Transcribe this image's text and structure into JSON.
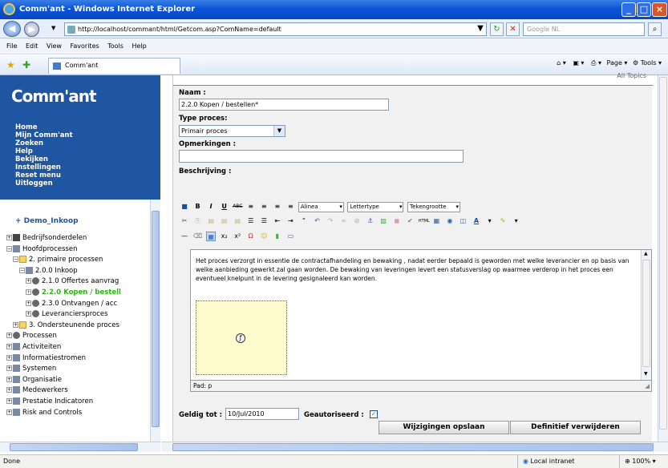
{
  "window": {
    "title": "Comm'ant - Windows Internet Explorer"
  },
  "address": {
    "url": "http://localhost/commant/html/Getcom.asp?ComName=default",
    "search_placeholder": "Google NL"
  },
  "menu": [
    "File",
    "Edit",
    "View",
    "Favorites",
    "Tools",
    "Help"
  ],
  "favbar": {
    "tab_label": "Comm'ant",
    "page_label": "Page",
    "tools_label": "Tools"
  },
  "sidebar": {
    "logo": "Comm'ant",
    "nav": [
      "Home",
      "Mijn Comm'ant",
      "Zoeken",
      "Help",
      "Bekijken",
      "Instellingen",
      "Reset menu",
      "Uitloggen"
    ],
    "tree_title": "+ Demo_Inkoop",
    "tree": [
      {
        "label": "Bedrijfsonderdelen",
        "indent": 0,
        "icon": "sq-icon"
      },
      {
        "label": "Hoofdprocessen",
        "indent": 0,
        "icon": "grid-icon"
      },
      {
        "label": "2. primaire processen",
        "indent": 1,
        "icon": "folder-icon"
      },
      {
        "label": "2.0.0 Inkoop",
        "indent": 2,
        "icon": "grid-icon"
      },
      {
        "label": "2.1.0 Offertes aanvrag",
        "indent": 3,
        "icon": "gear-icon"
      },
      {
        "label": "2.2.0 Kopen / bestell",
        "indent": 3,
        "icon": "gear-icon",
        "active": true
      },
      {
        "label": "2.3.0 Ontvangen / acc",
        "indent": 3,
        "icon": "gear-icon"
      },
      {
        "label": "Leveranciersproces",
        "indent": 3,
        "icon": "gear-icon"
      },
      {
        "label": "3. Ondersteunende proces",
        "indent": 1,
        "icon": "folder-icon"
      },
      {
        "label": "Processen",
        "indent": 0,
        "icon": "gear-icon"
      },
      {
        "label": "Activiteiten",
        "indent": 0,
        "icon": "grid-icon"
      },
      {
        "label": "Informatiestromen",
        "indent": 0,
        "icon": "info-icon"
      },
      {
        "label": "Systemen",
        "indent": 0,
        "icon": "monitor-icon"
      },
      {
        "label": "Organisatie",
        "indent": 0,
        "icon": "org-icon"
      },
      {
        "label": "Medewerkers",
        "indent": 0,
        "icon": "people-icon"
      },
      {
        "label": "Prestatie Indicatoren",
        "indent": 0,
        "icon": "gauge-icon"
      },
      {
        "label": "Risk and Controls",
        "indent": 0,
        "icon": "warning-icon"
      }
    ]
  },
  "form": {
    "top_right": "All Topics",
    "naam_label": "Naam :",
    "naam_value": "2.2.0 Kopen / bestellen*",
    "type_label": "Type proces:",
    "type_value": "Primair proces",
    "opm_label": "Opmerkingen :",
    "opm_value": "",
    "beschrijving_label": "Beschrijving :",
    "rte_paragraph": "Alinea",
    "rte_font": "Lettertype",
    "rte_size": "Tekengrootte",
    "editor_text": "Het proces verzorgt in essentie de contractafhandeling en bewaking , nadat eerder bepaald is geworden met welke leverancier en op basis van welke aanbieding gewerkt zal gaan worden. De bewaking van leveringen levert een statusverslag op waarmee verderop in het proces een eventueel knelpunt in de levering gesignaleerd kan worden.",
    "path_label": "Pad: p",
    "geldig_label": "Geldig tot :",
    "geldig_value": "10/Jul/2010",
    "geaut_label": "Geautoriseerd :",
    "save_button": "Wijzigingen opslaan",
    "delete_button": "Definitief verwijderen"
  },
  "status": {
    "left": "Done",
    "zone": "Local intranet",
    "zoom": "100%"
  }
}
